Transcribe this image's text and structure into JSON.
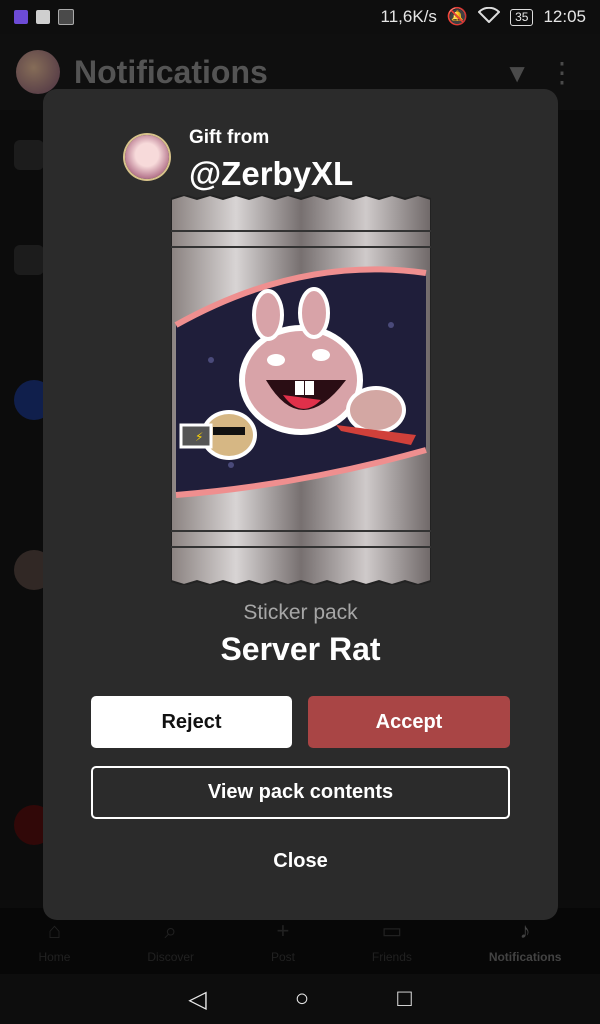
{
  "status_bar": {
    "speed": "11,6K/s",
    "battery": "35",
    "time": "12:05"
  },
  "background": {
    "title": "Notifications",
    "nav": [
      {
        "label": "Home",
        "icon": "home-icon"
      },
      {
        "label": "Discover",
        "icon": "search-icon"
      },
      {
        "label": "Post",
        "icon": "plus-icon"
      },
      {
        "label": "Friends",
        "icon": "chat-icon"
      },
      {
        "label": "Notifications",
        "icon": "bell-icon"
      }
    ]
  },
  "modal": {
    "gift_from_label": "Gift from",
    "sender": "@ZerbyXL",
    "pack_type": "Sticker pack",
    "pack_name": "Server Rat",
    "reject_label": "Reject",
    "accept_label": "Accept",
    "view_label": "View pack contents",
    "close_label": "Close"
  },
  "colors": {
    "accept": "#a94545",
    "modal_bg": "#2b2b2b"
  }
}
